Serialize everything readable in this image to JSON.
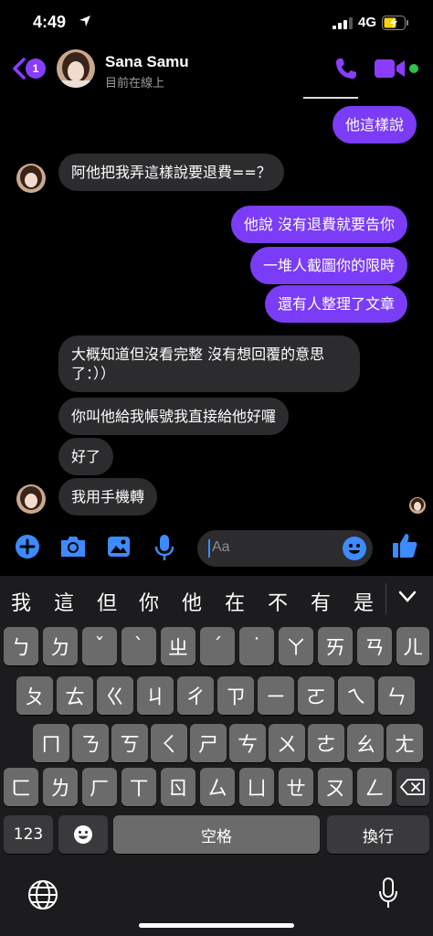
{
  "status_bar": {
    "time": "4:49",
    "network": "4G",
    "location_icon": "location-arrow-icon",
    "battery_icon": "battery-charging-icon"
  },
  "header": {
    "back_badge": "1",
    "contact_name": "Sana Samu",
    "presence": "目前在線上",
    "accent_color": "#8b3dff",
    "icons": {
      "call": "phone-icon",
      "video": "video-camera-icon",
      "back": "chevron-left-icon"
    }
  },
  "messages": [
    {
      "side": "out",
      "text": "他這樣說"
    },
    {
      "side": "in",
      "text": "阿他把我弄這樣說要退費==？"
    },
    {
      "side": "out",
      "text": "他說 沒有退費就要告你"
    },
    {
      "side": "out",
      "text": "一堆人截圖你的限時"
    },
    {
      "side": "out",
      "text": "還有人整理了文章"
    },
    {
      "side": "in",
      "line1": "大概知道但沒看完整 沒有想回覆的意思",
      "line2": "了：））"
    },
    {
      "side": "in",
      "text": "你叫他給我帳號我直接給他好囉"
    },
    {
      "side": "in",
      "text": "好了"
    },
    {
      "side": "in",
      "text": "我用手機轉"
    }
  ],
  "composer": {
    "placeholder": "Aa",
    "icons": [
      "plus-circle-icon",
      "camera-icon",
      "image-icon",
      "microphone-icon",
      "emoji-icon",
      "thumbs-up-icon"
    ]
  },
  "keyboard": {
    "candidates": [
      "我",
      "這",
      "但",
      "你",
      "他",
      "在",
      "不",
      "有",
      "是"
    ],
    "row1": [
      "ㄅ",
      "ㄉ",
      "ˇ",
      "ˋ",
      "ㄓ",
      "ˊ",
      "˙",
      "ㄚ",
      "ㄞ",
      "ㄢ",
      "ㄦ"
    ],
    "row2": [
      "ㄆ",
      "ㄊ",
      "ㄍ",
      "ㄐ",
      "ㄔ",
      "ㄗ",
      "ㄧ",
      "ㄛ",
      "ㄟ",
      "ㄣ"
    ],
    "row3": [
      "ㄇ",
      "ㄋ",
      "ㄎ",
      "ㄑ",
      "ㄕ",
      "ㄘ",
      "ㄨ",
      "ㄜ",
      "ㄠ",
      "ㄤ"
    ],
    "row4": [
      "ㄈ",
      "ㄌ",
      "ㄏ",
      "ㄒ",
      "ㄖ",
      "ㄙ",
      "ㄩ",
      "ㄝ",
      "ㄡ",
      "ㄥ"
    ],
    "num_label": "123",
    "space_label": "空格",
    "return_label": "換行"
  }
}
